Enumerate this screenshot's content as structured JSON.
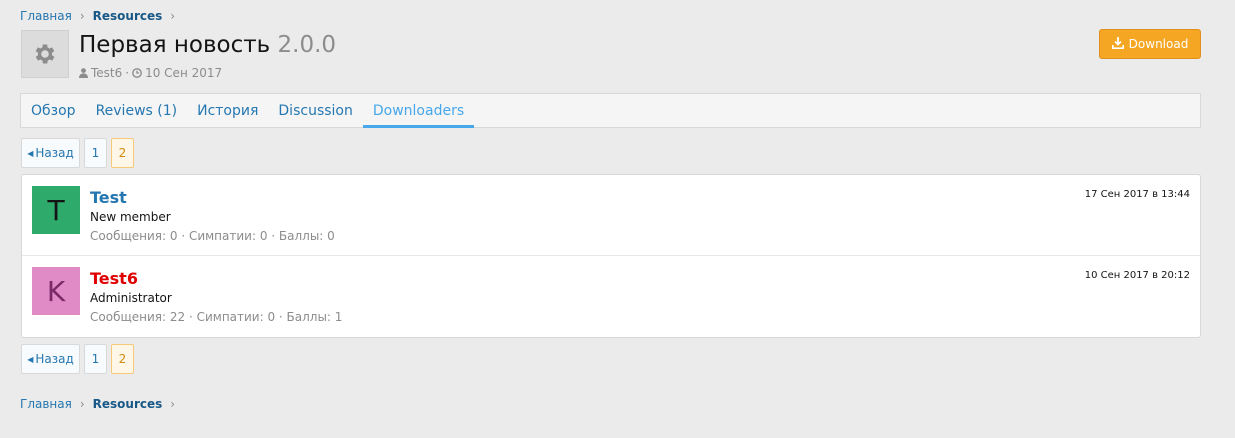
{
  "breadcrumb": {
    "home": "Главная",
    "section": "Resources",
    "separator": "›"
  },
  "resource": {
    "title": "Первая новость",
    "version": "2.0.0",
    "author": "Test6",
    "date": "10 Сен 2017",
    "icon": "gear-icon"
  },
  "download_button": {
    "label": "Download",
    "icon": "download-icon",
    "color": "#f5a623"
  },
  "tabs": [
    {
      "label": "Обзор"
    },
    {
      "label": "Reviews (1)"
    },
    {
      "label": "История"
    },
    {
      "label": "Discussion"
    },
    {
      "label": "Downloaders",
      "active": true
    }
  ],
  "pagination": {
    "prev_label": "Назад",
    "pages": [
      "1",
      "2"
    ],
    "current": "2"
  },
  "downloaders": [
    {
      "letter": "T",
      "name": "Test",
      "name_color": "#2577b1",
      "avatar_bg": "#2eaa6a",
      "avatar_fg": "#141414",
      "title": "New member",
      "stats": "Сообщения: 0 · Симпатии: 0 · Баллы: 0",
      "date": "17 Сен 2017 в 13:44"
    },
    {
      "letter": "K",
      "name": "Test6",
      "name_color": "#e00000",
      "avatar_bg": "#e08ac6",
      "avatar_fg": "#7a2a66",
      "title": "Administrator",
      "stats": "Сообщения: 22 · Симпатии: 0 · Баллы: 1",
      "date": "10 Сен 2017 в 20:12"
    }
  ]
}
